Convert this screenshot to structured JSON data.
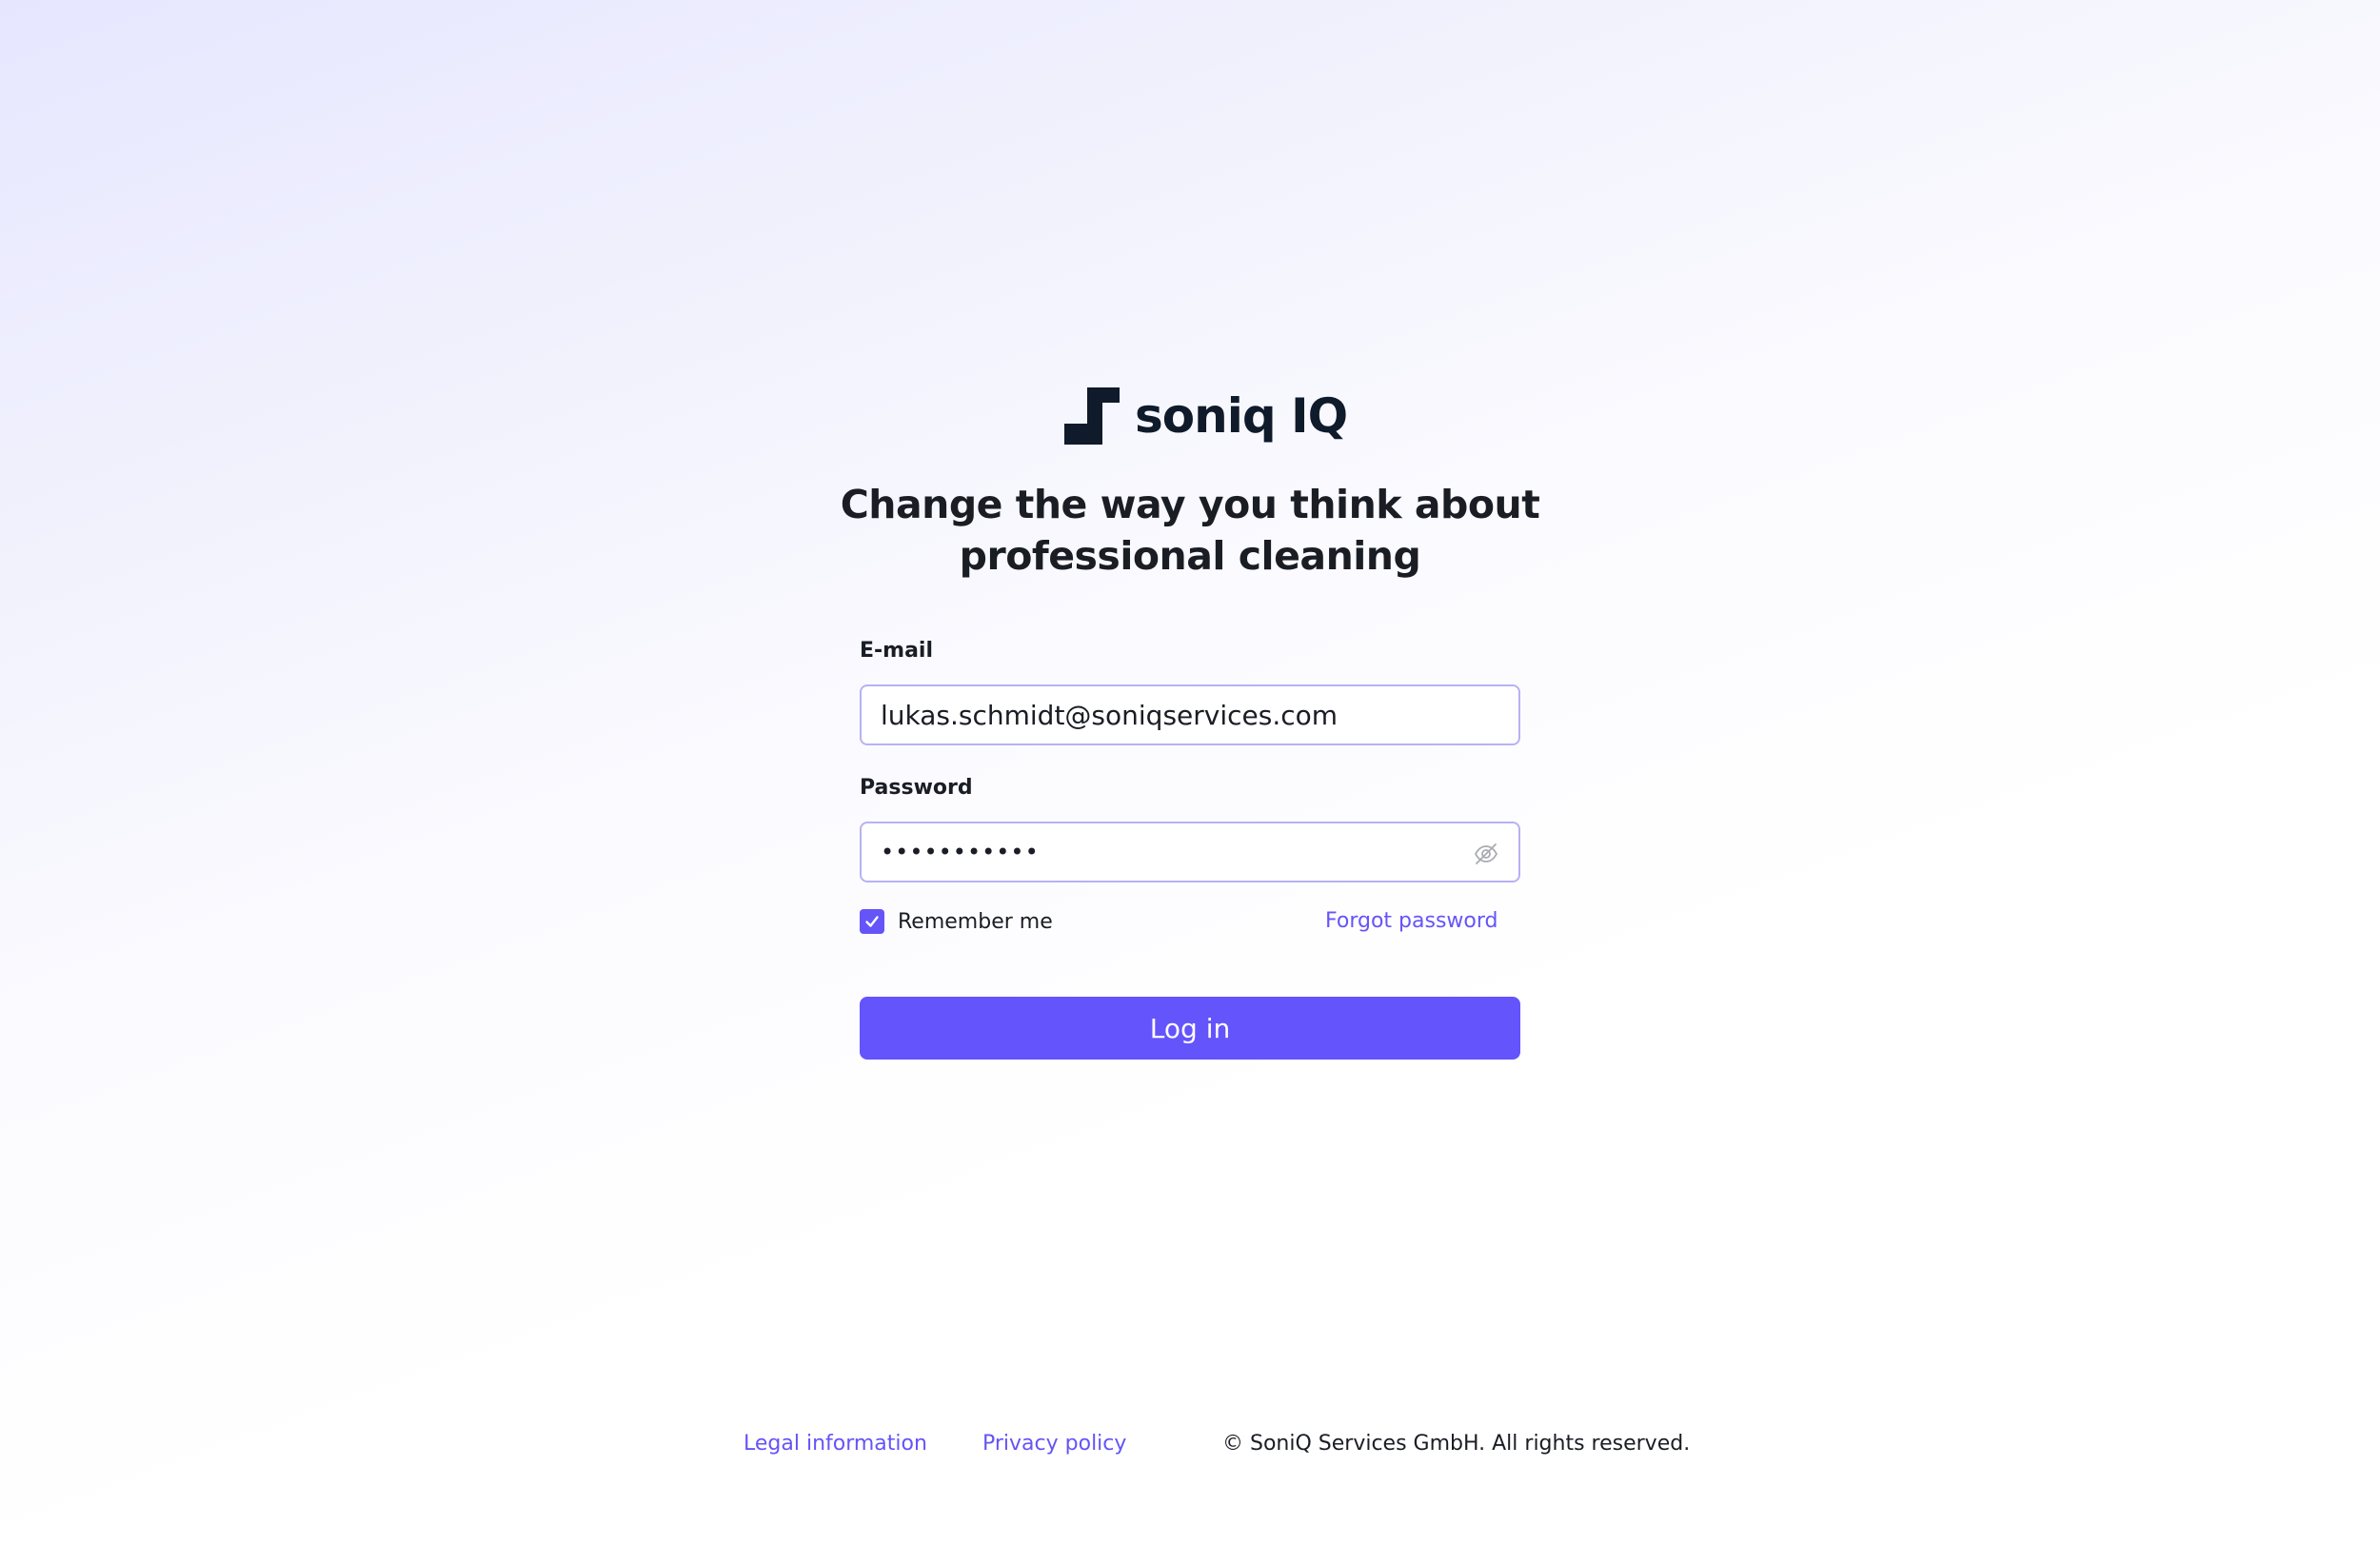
{
  "brand": {
    "name": "soniq IQ",
    "logo_icon": "soniq-s-mark",
    "logo_color": "#0f1a2b"
  },
  "headline": {
    "line1": "Change the way you think about",
    "line2": "professional cleaning"
  },
  "form": {
    "email_label": "E-mail",
    "email_value": "lukas.schmidt@soniqservices.com",
    "password_label": "Password",
    "password_masked": "•••••••••••",
    "password_visibility_icon": "eye-off-icon",
    "remember_label": "Remember me",
    "remember_checked": true,
    "forgot_label": "Forgot password",
    "login_label": "Log in"
  },
  "footer": {
    "legal_label": "Legal information",
    "privacy_label": "Privacy policy",
    "copyright": "© SoniQ Services GmbH. All rights reserved."
  },
  "colors": {
    "accent": "#6454fb",
    "text": "#1a1d24",
    "input_border": "#b7b2f3"
  }
}
